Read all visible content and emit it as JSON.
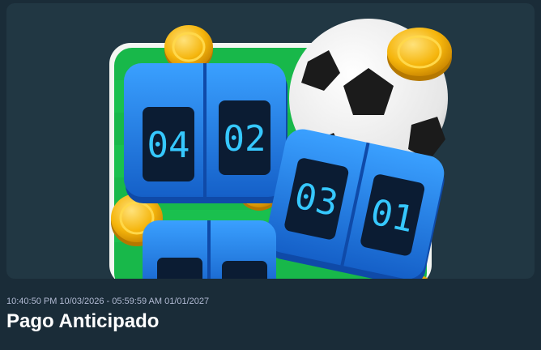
{
  "promotion": {
    "date_range": "10:40:50 PM 10/03/2026 - 05:59:59 AM 01/01/2027",
    "title": "Pago Anticipado",
    "image_icon": "football-scoreboard-coins-illustration"
  },
  "scoreboard": {
    "top_left": "04",
    "top_right": "02",
    "bottom_left": "03",
    "bottom_right": "01"
  },
  "colors": {
    "page_background": "#1a2c38",
    "banner_background": "#213743",
    "pitch_green": "#18b84a",
    "board_blue": "#1e7fe0",
    "led_text": "#36c8ff",
    "coin_gold": "#f5b50c",
    "title_text": "#ffffff",
    "meta_text": "#b1bad3"
  }
}
